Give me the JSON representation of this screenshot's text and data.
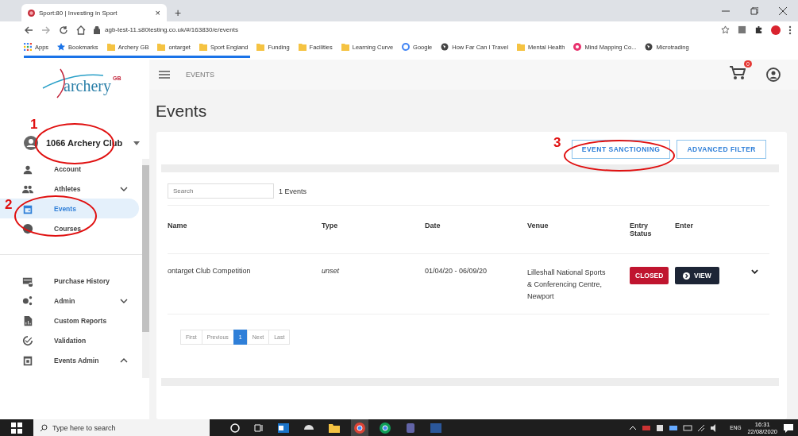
{
  "browser": {
    "tab_title": "Sport:80 | Investing in Sport",
    "tab_close": "×",
    "new_tab": "+",
    "url": "agb-test-11.s80testing.co.uk/#/163830/e/events",
    "bookmarks": [
      {
        "kind": "apps",
        "label": "Apps"
      },
      {
        "kind": "star",
        "label": "Bookmarks"
      },
      {
        "kind": "folder",
        "label": "Archery GB"
      },
      {
        "kind": "folder",
        "label": "ontarget"
      },
      {
        "kind": "folder",
        "label": "Sport England"
      },
      {
        "kind": "folder",
        "label": "Funding"
      },
      {
        "kind": "folder",
        "label": "Facilities"
      },
      {
        "kind": "folder",
        "label": "Learning Curve"
      },
      {
        "kind": "google",
        "label": "Google"
      },
      {
        "kind": "globe",
        "label": "How Far Can I Travel"
      },
      {
        "kind": "folder",
        "label": "Mental Health"
      },
      {
        "kind": "mindmap",
        "label": "Mind Mapping Co..."
      },
      {
        "kind": "globe",
        "label": "Microtrading"
      }
    ]
  },
  "sidebar": {
    "logo": "archery",
    "logo_sup": "GB",
    "club": "1066 Archery Club",
    "sections": [
      {
        "items": [
          {
            "label": "Account",
            "selected": false
          },
          {
            "label": "Athletes",
            "selected": false,
            "expanded": false
          },
          {
            "label": "Events",
            "selected": true
          },
          {
            "label": "Courses",
            "selected": false
          }
        ]
      },
      {
        "items": [
          {
            "label": "Purchase History",
            "selected": false
          },
          {
            "label": "Admin",
            "selected": false,
            "expanded": false
          },
          {
            "label": "Custom Reports",
            "selected": false
          },
          {
            "label": "Validation",
            "selected": false
          },
          {
            "label": "Events Admin",
            "selected": false,
            "expanded": true
          }
        ]
      }
    ]
  },
  "topbar": {
    "title": "EVENTS",
    "cart_count": "0"
  },
  "page": {
    "heading": "Events",
    "buttons": [
      "EVENT SANCTIONING",
      "ADVANCED FILTER"
    ],
    "search": {
      "placeholder": "Search"
    },
    "count": "1 Events",
    "table": {
      "columns": [
        "Name",
        "Type",
        "Date",
        "Venue",
        "Entry Status",
        "Enter"
      ],
      "rows": [
        {
          "name": "ontarget Club Competition",
          "type": "unset",
          "date": "01/04/20 - 06/09/20",
          "venue": "Lilleshall National Sports & Conferencing Centre, Newport",
          "status": "CLOSED",
          "action": "VIEW"
        }
      ]
    },
    "pagination": [
      {
        "label": "First",
        "selected": false
      },
      {
        "label": "Previous",
        "selected": false
      },
      {
        "label": "1",
        "selected": true
      },
      {
        "label": "Next",
        "selected": false
      },
      {
        "label": "Last",
        "selected": false
      }
    ]
  },
  "annotations": [
    {
      "label": "1"
    },
    {
      "label": "2"
    },
    {
      "label": "3"
    }
  ],
  "taskbar": {
    "search": {
      "placeholder": "Type here to search"
    },
    "lang": "ENG",
    "time": "16:31",
    "date": "22/08/2020"
  }
}
